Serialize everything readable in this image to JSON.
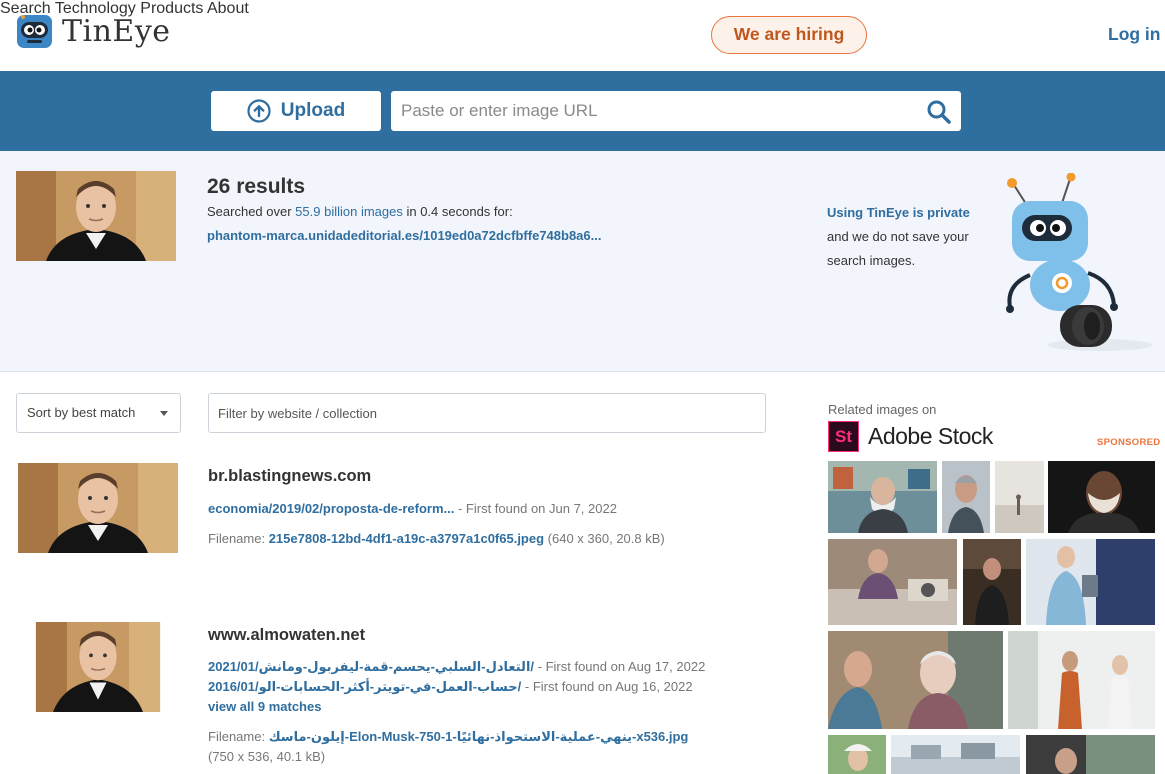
{
  "header": {
    "logo_text": "TinEye",
    "nav": [
      "Search",
      "Technology",
      "Products",
      "About"
    ],
    "hiring": "We are hiring",
    "login": "Log in"
  },
  "search": {
    "upload_label": "Upload",
    "url_placeholder": "Paste or enter image URL"
  },
  "summary": {
    "count": "26 results",
    "searched_prefix": "Searched over ",
    "searched_highlight": "55.9 billion images",
    "searched_suffix": " in 0.4 seconds for:",
    "query_url": "phantom-marca.unidadeditorial.es/1019ed0a72dcfbffe748b8a6...",
    "privacy_link": "Using TinEye is private",
    "privacy_text1": "and we do not save your",
    "privacy_text2": "search images."
  },
  "filters": {
    "sort_value": "Sort by best match",
    "filter_placeholder": "Filter by website / collection"
  },
  "results": [
    {
      "domain": "br.blastingnews.com",
      "matches": [
        {
          "link": "economia/2019/02/proposta-de-reform...",
          "found": " - First found on Jun 7, 2022"
        }
      ],
      "filename_label": "Filename: ",
      "filename": "215e7808-12bd-4df1-a19c-a3797a1c0f65.jpeg",
      "fileinfo": " (640 x 360, 20.8 kB)"
    },
    {
      "domain": "www.almowaten.net",
      "matches": [
        {
          "link": "2021/01/التعادل-السلبي-يحسم-قمة-ليفربول-ومانش/",
          "found": " - First found on Aug 17, 2022"
        },
        {
          "link": "2016/01/حساب-العمل-في-تويتر-أكثر-الحسابات-الو/",
          "found": " - First found on Aug 16, 2022"
        }
      ],
      "view_all": "view all 9 matches",
      "filename_label": "Filename: ",
      "filename": "إيلون-ماسك-Elon-Musk-750-1-ينهي-عملية-الاستحواذ-نهائيًا-x536.jpg",
      "fileinfo": "(750 x 536, 40.1 kB)"
    }
  ],
  "sidebar": {
    "related_label": "Related images on",
    "stock_logo_letters": "St",
    "stock_name": "Adobe Stock",
    "sponsored": "SPONSORED"
  },
  "colors": {
    "brand_blue": "#2f6fa0",
    "link_blue": "#2f6e9f",
    "accent_orange": "#e9753c",
    "panel_bg": "#f2f5fb"
  }
}
